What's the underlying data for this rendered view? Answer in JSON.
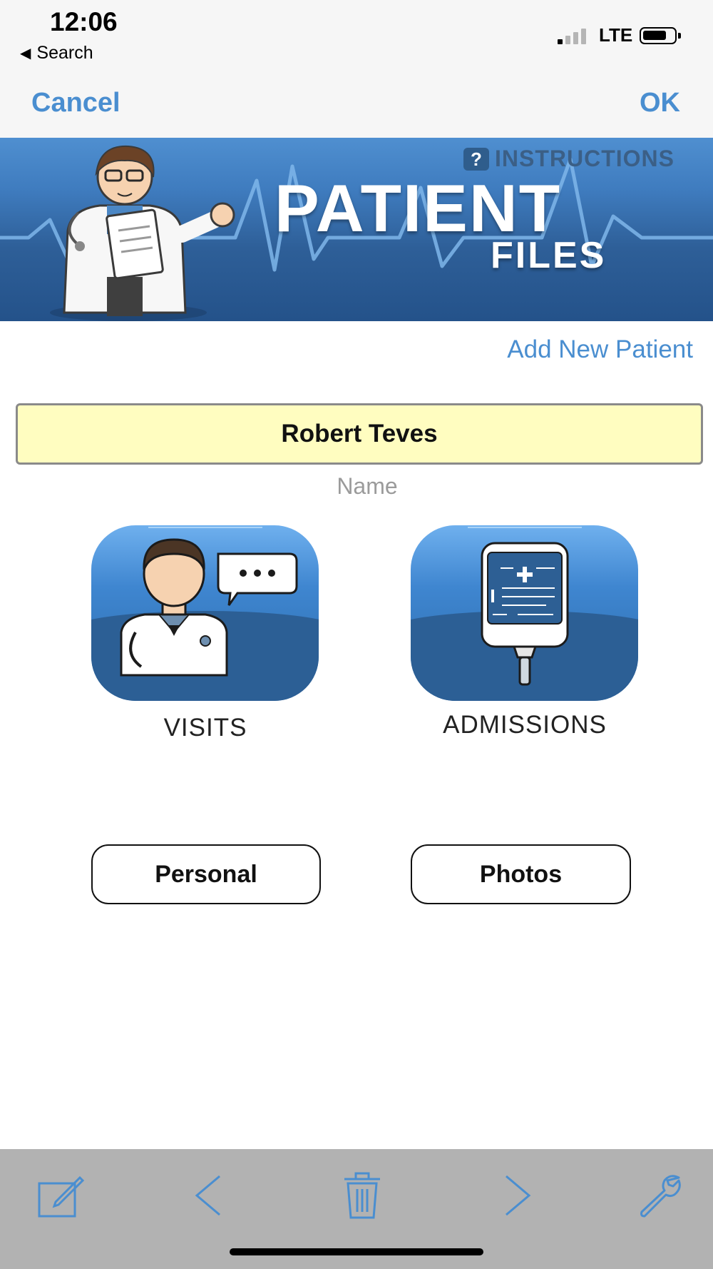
{
  "status_bar": {
    "time": "12:06",
    "back_label": "Search",
    "network": "LTE"
  },
  "nav": {
    "cancel": "Cancel",
    "ok": "OK"
  },
  "banner": {
    "instructions": "INSTRUCTIONS",
    "title": "PATIENT",
    "subtitle": "FILES"
  },
  "actions": {
    "add_new_patient": "Add New Patient"
  },
  "patient": {
    "name": "Robert Teves",
    "name_label": "Name"
  },
  "tiles": [
    {
      "label": "VISITS",
      "icon": "doctor-speech-icon"
    },
    {
      "label": "ADMISSIONS",
      "icon": "iv-bag-icon"
    }
  ],
  "buttons": {
    "personal": "Personal",
    "photos": "Photos"
  },
  "toolbar": {
    "icons": [
      "edit-icon",
      "chevron-left-icon",
      "trash-icon",
      "chevron-right-icon",
      "wrench-icon"
    ]
  },
  "colors": {
    "accent": "#4a8ed0",
    "banner": "#2e5f98",
    "name_field": "#fffdc0",
    "toolbar": "#b2b2b2"
  }
}
